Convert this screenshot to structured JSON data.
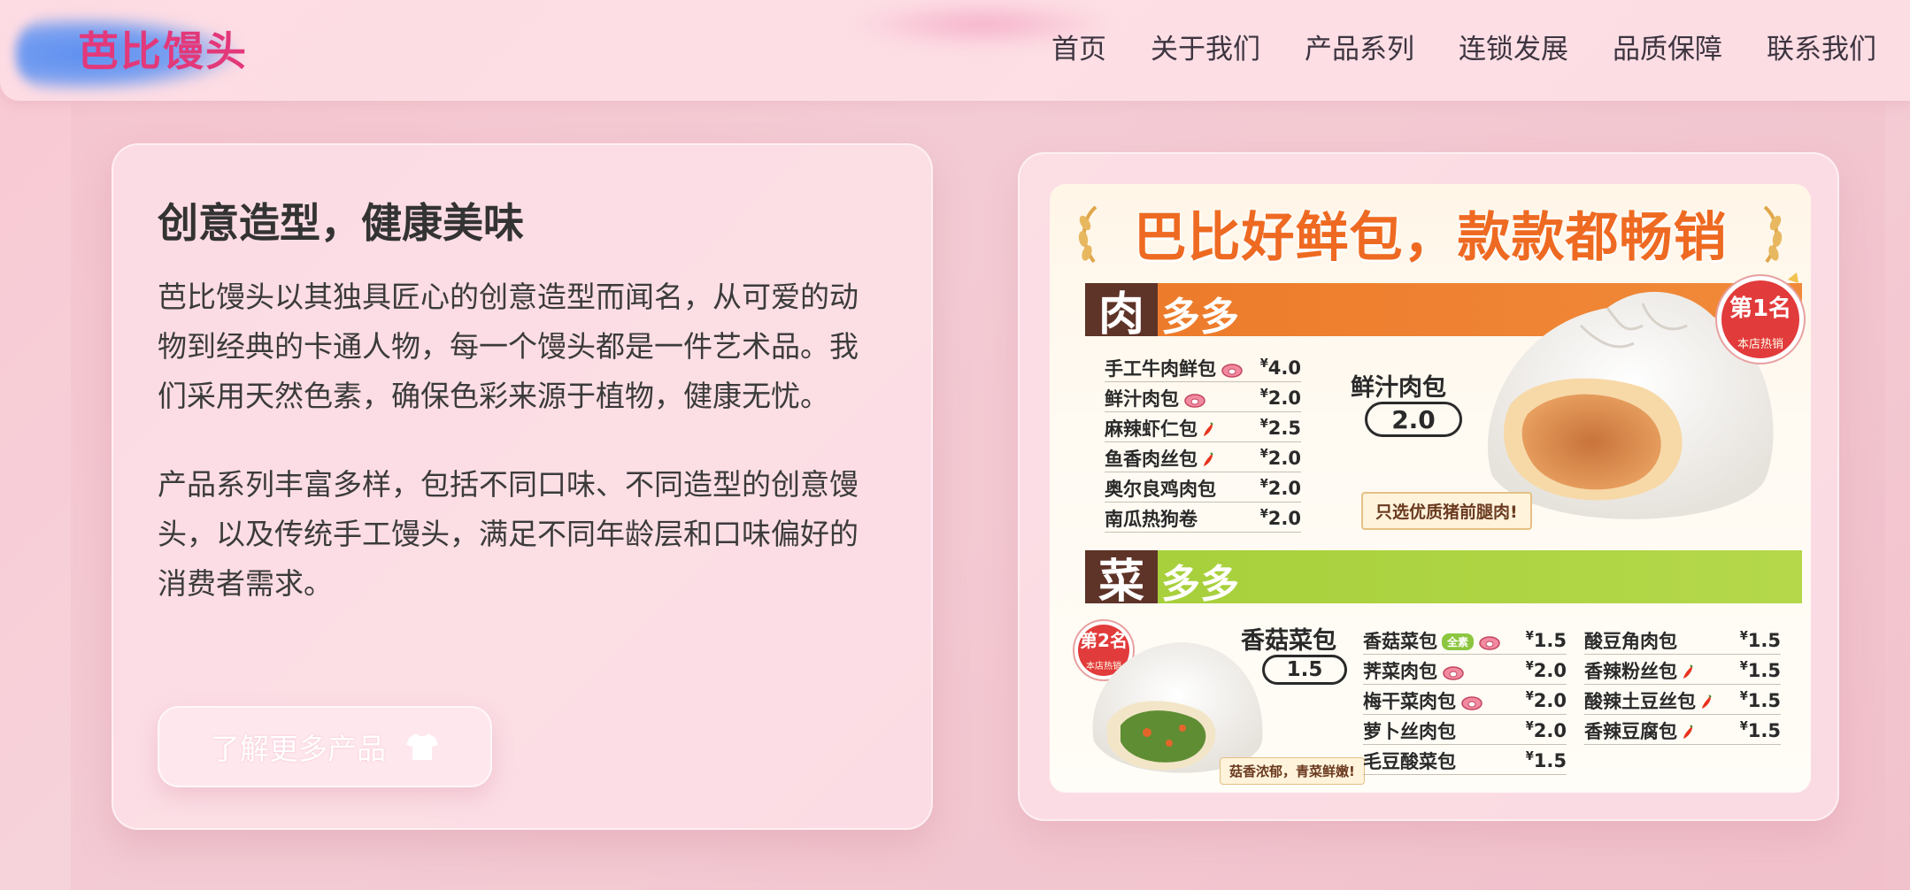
{
  "header": {
    "logo": "芭比馒头",
    "nav": [
      "首页",
      "关于我们",
      "产品系列",
      "连锁发展",
      "品质保障",
      "联系我们"
    ]
  },
  "intro": {
    "title": "创意造型，健康美味",
    "paragraph1": "芭比馒头以其独具匠心的创意造型而闻名，从可爱的动物到经典的卡通人物，每一个馒头都是一件艺术品。我们采用天然色素，确保色彩来源于植物，健康无忧。",
    "paragraph2": "产品系列丰富多样，包括不同口味、不同造型的创意馒头，以及传统手工馒头，满足不同年龄层和口味偏好的消费者需求。",
    "button_label": "了解更多产品",
    "button_icon": "shirt-icon"
  },
  "menu": {
    "title": "巴比好鲜包，款款都畅销",
    "meat": {
      "char": "肉",
      "rest": "多多",
      "items": [
        {
          "name": "手工牛肉鲜包",
          "price": "4.0",
          "tag": "pig"
        },
        {
          "name": "鲜汁肉包",
          "price": "2.0",
          "tag": "pig"
        },
        {
          "name": "麻辣虾仁包",
          "price": "2.5",
          "tag": "chili"
        },
        {
          "name": "鱼香肉丝包",
          "price": "2.0",
          "tag": "chili"
        },
        {
          "name": "奥尔良鸡肉包",
          "price": "2.0",
          "tag": ""
        },
        {
          "name": "南瓜热狗卷",
          "price": "2.0",
          "tag": ""
        }
      ],
      "feature_name": "鲜汁肉包",
      "feature_price": "2.0",
      "callout": "只选优质猪前腿肉!",
      "rank_main": "第1名",
      "rank_sub": "本店热销"
    },
    "veg": {
      "char": "菜",
      "rest": "多多",
      "col1": [
        {
          "name": "香菇菜包",
          "price": "1.5",
          "tag": "vegan-pig"
        },
        {
          "name": "荠菜肉包",
          "price": "2.0",
          "tag": "pig"
        },
        {
          "name": "梅干菜肉包",
          "price": "2.0",
          "tag": "pig"
        },
        {
          "name": "萝卜丝肉包",
          "price": "2.0",
          "tag": ""
        },
        {
          "name": "毛豆酸菜包",
          "price": "1.5",
          "tag": ""
        }
      ],
      "col2": [
        {
          "name": "酸豆角肉包",
          "price": "1.5",
          "tag": ""
        },
        {
          "name": "香辣粉丝包",
          "price": "1.5",
          "tag": "chili"
        },
        {
          "name": "酸辣土豆丝包",
          "price": "1.5",
          "tag": "chili"
        },
        {
          "name": "香辣豆腐包",
          "price": "1.5",
          "tag": "chili"
        }
      ],
      "feature_name": "香菇菜包",
      "feature_price": "1.5",
      "callout": "菇香浓郁，青菜鲜嫩!",
      "rank_main": "第2名",
      "rank_sub": "本店热销",
      "vegan_label": "全素"
    },
    "yen": "¥"
  },
  "colors": {
    "accent": "#e3387a",
    "meat_bar": "#ec7a2a",
    "veg_bar": "#a6cf3a",
    "menu_title": "#ee6a22"
  }
}
